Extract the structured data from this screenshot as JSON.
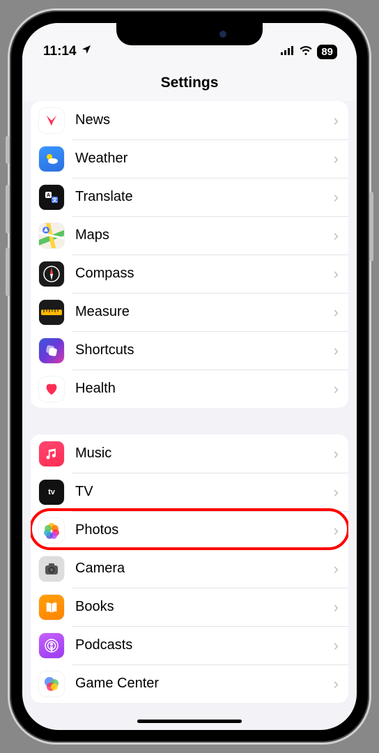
{
  "status": {
    "time": "11:14",
    "battery": "89"
  },
  "header": {
    "title": "Settings"
  },
  "groups": [
    {
      "items": [
        {
          "id": "news",
          "label": "News"
        },
        {
          "id": "weather",
          "label": "Weather"
        },
        {
          "id": "translate",
          "label": "Translate"
        },
        {
          "id": "maps",
          "label": "Maps"
        },
        {
          "id": "compass",
          "label": "Compass"
        },
        {
          "id": "measure",
          "label": "Measure"
        },
        {
          "id": "shortcuts",
          "label": "Shortcuts"
        },
        {
          "id": "health",
          "label": "Health"
        }
      ]
    },
    {
      "items": [
        {
          "id": "music",
          "label": "Music"
        },
        {
          "id": "tv",
          "label": "TV"
        },
        {
          "id": "photos",
          "label": "Photos",
          "highlighted": true
        },
        {
          "id": "camera",
          "label": "Camera"
        },
        {
          "id": "books",
          "label": "Books"
        },
        {
          "id": "podcasts",
          "label": "Podcasts"
        },
        {
          "id": "gamecenter",
          "label": "Game Center"
        }
      ]
    }
  ],
  "annotation": {
    "highlighted_item": "photos",
    "highlight_color": "#ff0000"
  }
}
